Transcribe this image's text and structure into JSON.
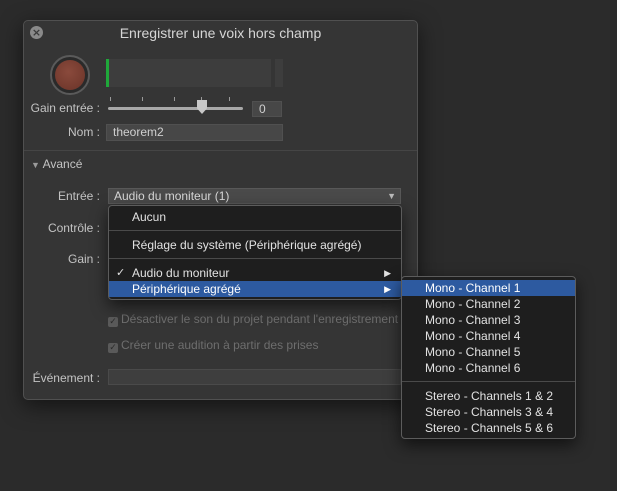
{
  "dialog": {
    "title": "Enregistrer une voix hors champ",
    "gain_label": "Gain entrée :",
    "gain_value": "0",
    "gain_level": 0.7,
    "name_label": "Nom :",
    "name_value": "theorem2",
    "advanced_label": "Avancé",
    "input_label": "Entrée :",
    "input_value": "Audio du moniteur (1)",
    "monitor_label": "Contrôle :",
    "gain2_label": "Gain :",
    "mute_checkbox_label": "Désactiver le son du projet pendant l'enregistrement",
    "audition_checkbox_label": "Créer une audition à partir des prises",
    "event_label": "Événement :"
  },
  "input_menu": {
    "items": [
      {
        "label": "Aucun",
        "checked": false,
        "submenu": false,
        "selected": false
      },
      {
        "label": "Réglage du système (Périphérique agrégé)",
        "checked": false,
        "submenu": false,
        "selected": false
      },
      {
        "label": "Audio du moniteur",
        "checked": true,
        "submenu": true,
        "selected": false
      },
      {
        "label": "Périphérique agrégé",
        "checked": false,
        "submenu": true,
        "selected": true
      }
    ]
  },
  "channel_menu": {
    "mono": [
      "Mono - Channel 1",
      "Mono - Channel 2",
      "Mono - Channel 3",
      "Mono - Channel 4",
      "Mono - Channel 5",
      "Mono - Channel 6"
    ],
    "stereo": [
      "Stereo - Channels 1 & 2",
      "Stereo - Channels 3 & 4",
      "Stereo - Channels 5 & 6"
    ],
    "selected_index": 0
  },
  "colors": {
    "accent": "#2d5aa0",
    "meter_green": "#1fa83a",
    "record_red": "#7a3d31"
  },
  "icons": {
    "close": "close-icon",
    "disclosure": "disclosure-triangle-icon",
    "checkmark": "checkmark-icon",
    "submenu": "submenu-arrow-icon",
    "popup": "popup-arrow-icon"
  }
}
